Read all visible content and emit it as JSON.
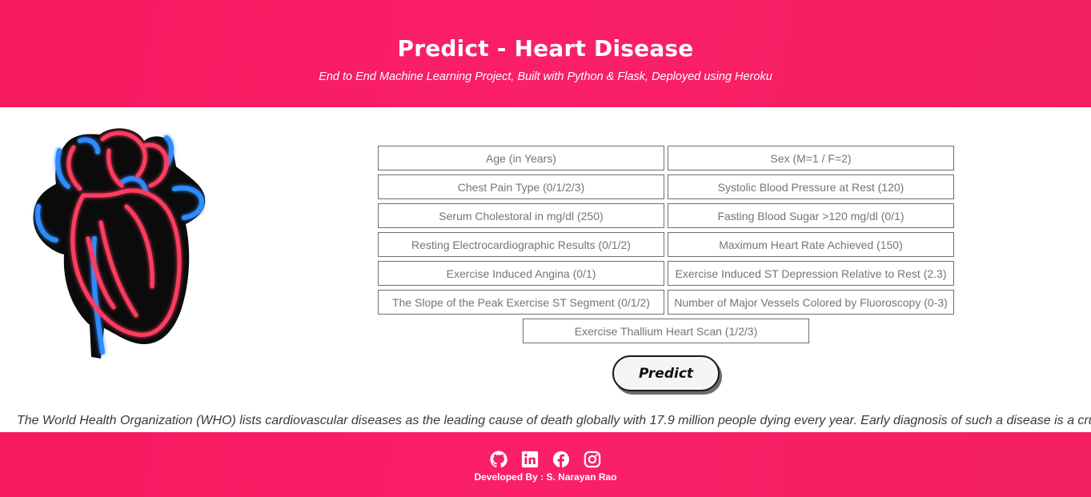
{
  "header": {
    "title": "Predict - Heart Disease",
    "subtitle": "End to End Machine Learning Project, Built with Python & Flask, Deployed using Heroku"
  },
  "form": {
    "fields": [
      {
        "placeholder": "Age (in Years)"
      },
      {
        "placeholder": "Sex (M=1 / F=2)"
      },
      {
        "placeholder": "Chest Pain Type (0/1/2/3)"
      },
      {
        "placeholder": "Systolic Blood Pressure at Rest (120)"
      },
      {
        "placeholder": "Serum Cholestoral in mg/dl (250)"
      },
      {
        "placeholder": "Fasting Blood Sugar >120 mg/dl (0/1)"
      },
      {
        "placeholder": "Resting Electrocardiographic Results (0/1/2)"
      },
      {
        "placeholder": "Maximum Heart Rate Achieved (150)"
      },
      {
        "placeholder": "Exercise Induced Angina (0/1)"
      },
      {
        "placeholder": "Exercise Induced ST Depression Relative to Rest (2.3)"
      },
      {
        "placeholder": "The Slope of the Peak Exercise ST Segment (0/1/2)"
      },
      {
        "placeholder": "Number of Major Vessels Colored by Fluoroscopy (0-3)"
      },
      {
        "placeholder": "Exercise Thallium Heart Scan (1/2/3)"
      }
    ],
    "predict_label": "Predict"
  },
  "marquee": {
    "text": "The World Health Organization (WHO) lists cardiovascular diseases as the leading cause of death globally with 17.9 million people dying every year. Early diagnosis of such a disease is a cru"
  },
  "footer": {
    "icons": [
      "github-icon",
      "linkedin-icon",
      "facebook-icon",
      "instagram-icon"
    ],
    "developer": "Developed By : S. Narayan Rao"
  },
  "colors": {
    "accent": "#f5195f",
    "heart_red": "#ff3a5c",
    "heart_blue": "#2d8bff"
  }
}
